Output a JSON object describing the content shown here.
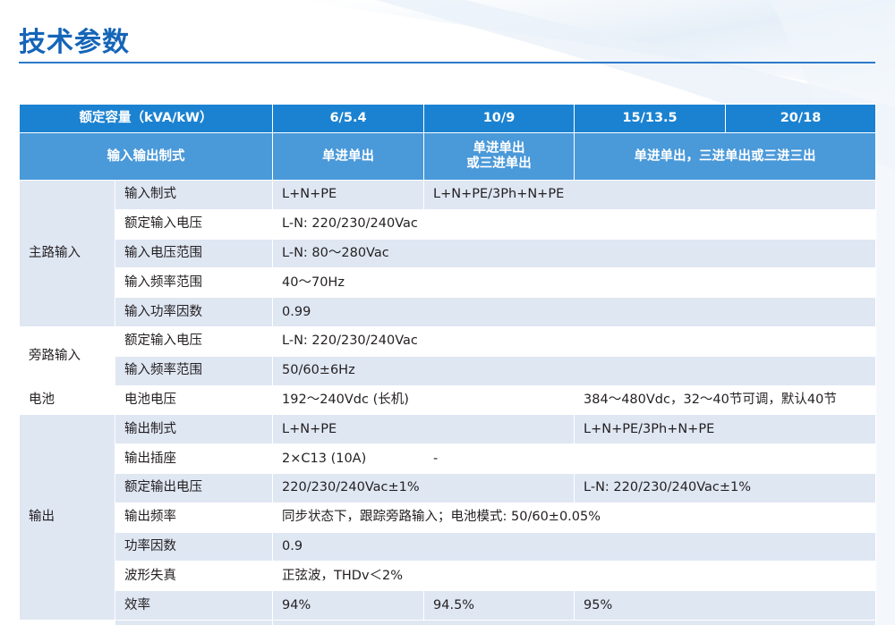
{
  "title": "技术参数",
  "header": {
    "capacity_label": "额定容量（kVA/kW）",
    "capacities": [
      "6/5.4",
      "10/9",
      "15/13.5",
      "20/18"
    ],
    "io_label": "输入输出制式",
    "io_a": "单进单出",
    "io_b": "单进单出\n或三进单出",
    "io_c": "单进单出，三进单出或三进三出"
  },
  "sections": {
    "main_input": {
      "label": "主路输入",
      "rows": [
        {
          "name": "输入制式",
          "v1": "L+N+PE",
          "v2": "L+N+PE/3Ph+N+PE"
        },
        {
          "name": "额定输入电压",
          "v1": "L-N: 220/230/240Vac"
        },
        {
          "name": "输入电压范围",
          "v1": "L-N: 80～280Vac"
        },
        {
          "name": "输入频率范围",
          "v1": "40～70Hz"
        },
        {
          "name": "输入功率因数",
          "v1": "0.99"
        }
      ]
    },
    "bypass_input": {
      "label": "旁路输入",
      "rows": [
        {
          "name": "额定输入电压",
          "v1": "L-N: 220/230/240Vac"
        },
        {
          "name": "输入频率范围",
          "v1": "50/60±6Hz"
        }
      ]
    },
    "battery": {
      "label": "电池",
      "rows": [
        {
          "name": "电池电压",
          "v1": "192～240Vdc (长机)",
          "v2": "384～480Vdc，32～40节可调，默认40节"
        }
      ]
    },
    "output": {
      "label": "输出",
      "rows": [
        {
          "name": "输出制式",
          "v1": "L+N+PE",
          "v2": "L+N+PE/3Ph+N+PE"
        },
        {
          "name": "输出插座",
          "v1": "2×C13 (10A)",
          "v2": "-"
        },
        {
          "name": "额定输出电压",
          "v1": "220/230/240Vac±1%",
          "v2": "L-N: 220/230/240Vac±1%"
        },
        {
          "name": "输出频率",
          "v1": "同步状态下，跟踪旁路输入；电池模式: 50/60±0.05%"
        },
        {
          "name": "功率因数",
          "v1": "0.9"
        },
        {
          "name": "波形失真",
          "v1": "正弦波，THDv＜2%"
        },
        {
          "name": "效率",
          "v1": "94%",
          "v2": "94.5%",
          "v3": "95%"
        }
      ]
    }
  },
  "colors": {
    "title": "#1565b8",
    "header_dark": "#1b82d1",
    "header_light": "#4a99d9",
    "row_shade": "#dfe7f3"
  }
}
